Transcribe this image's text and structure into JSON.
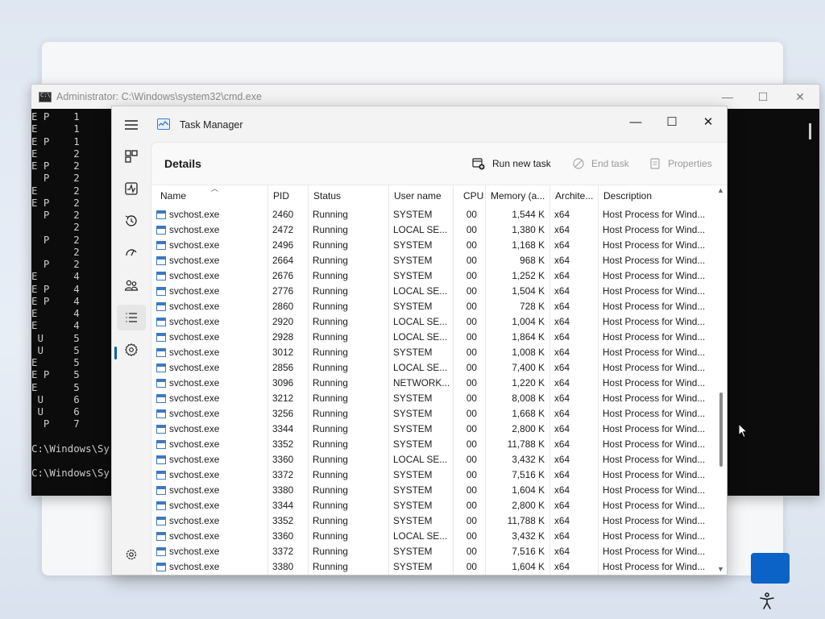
{
  "cmd": {
    "title": "Administrator: C:\\Windows\\system32\\cmd.exe",
    "controls": {
      "minimize": "—",
      "maximize": "☐",
      "close": "✕"
    },
    "lines": [
      "E P    1",
      "E      1",
      "E P    1",
      "E      2",
      "E P    2",
      "  P    2",
      "E      2",
      "E P    2",
      "  P    2",
      "       2",
      "  P    2",
      "       2",
      "  P    2",
      "E      4",
      "E P    4",
      "E P    4",
      "E      4",
      "E      4",
      " U     5",
      " U     5",
      "E      5",
      "E P    5",
      "E      5",
      " U     6",
      " U     6",
      "  P    7",
      "",
      "C:\\Windows\\Sy",
      "",
      "C:\\Windows\\Sy"
    ]
  },
  "taskmgr": {
    "title": "Task Manager",
    "controls": {
      "minimize": "—",
      "maximize": "☐",
      "close": "✕"
    },
    "nav": [
      {
        "name": "processes",
        "icon": "processes-icon"
      },
      {
        "name": "performance",
        "icon": "performance-icon"
      },
      {
        "name": "app-history",
        "icon": "app-history-icon"
      },
      {
        "name": "startup-apps",
        "icon": "startup-apps-icon"
      },
      {
        "name": "users",
        "icon": "users-icon"
      },
      {
        "name": "details",
        "icon": "details-icon",
        "active": true
      },
      {
        "name": "services",
        "icon": "services-icon"
      },
      {
        "name": "settings",
        "icon": "settings-icon"
      }
    ],
    "page_title": "Details",
    "toolbar": {
      "run_new_task": "Run new task",
      "end_task": "End task",
      "properties": "Properties"
    },
    "columns": [
      "Name",
      "PID",
      "Status",
      "User name",
      "CPU",
      "Memory (a...",
      "Archite...",
      "Description"
    ],
    "rows": [
      [
        "svchost.exe",
        "2460",
        "Running",
        "SYSTEM",
        "00",
        "1,544 K",
        "x64",
        "Host Process for Wind..."
      ],
      [
        "svchost.exe",
        "2472",
        "Running",
        "LOCAL SE...",
        "00",
        "1,380 K",
        "x64",
        "Host Process for Wind..."
      ],
      [
        "svchost.exe",
        "2496",
        "Running",
        "SYSTEM",
        "00",
        "1,168 K",
        "x64",
        "Host Process for Wind..."
      ],
      [
        "svchost.exe",
        "2664",
        "Running",
        "SYSTEM",
        "00",
        "968 K",
        "x64",
        "Host Process for Wind..."
      ],
      [
        "svchost.exe",
        "2676",
        "Running",
        "SYSTEM",
        "00",
        "1,252 K",
        "x64",
        "Host Process for Wind..."
      ],
      [
        "svchost.exe",
        "2776",
        "Running",
        "LOCAL SE...",
        "00",
        "1,504 K",
        "x64",
        "Host Process for Wind..."
      ],
      [
        "svchost.exe",
        "2860",
        "Running",
        "SYSTEM",
        "00",
        "728 K",
        "x64",
        "Host Process for Wind..."
      ],
      [
        "svchost.exe",
        "2920",
        "Running",
        "LOCAL SE...",
        "00",
        "1,004 K",
        "x64",
        "Host Process for Wind..."
      ],
      [
        "svchost.exe",
        "2928",
        "Running",
        "LOCAL SE...",
        "00",
        "1,864 K",
        "x64",
        "Host Process for Wind..."
      ],
      [
        "svchost.exe",
        "3012",
        "Running",
        "SYSTEM",
        "00",
        "1,008 K",
        "x64",
        "Host Process for Wind..."
      ],
      [
        "svchost.exe",
        "2856",
        "Running",
        "LOCAL SE...",
        "00",
        "7,400 K",
        "x64",
        "Host Process for Wind..."
      ],
      [
        "svchost.exe",
        "3096",
        "Running",
        "NETWORK...",
        "00",
        "1,220 K",
        "x64",
        "Host Process for Wind..."
      ],
      [
        "svchost.exe",
        "3212",
        "Running",
        "SYSTEM",
        "00",
        "8,008 K",
        "x64",
        "Host Process for Wind..."
      ],
      [
        "svchost.exe",
        "3256",
        "Running",
        "SYSTEM",
        "00",
        "1,668 K",
        "x64",
        "Host Process for Wind..."
      ],
      [
        "svchost.exe",
        "3344",
        "Running",
        "SYSTEM",
        "00",
        "2,800 K",
        "x64",
        "Host Process for Wind..."
      ],
      [
        "svchost.exe",
        "3352",
        "Running",
        "SYSTEM",
        "00",
        "11,788 K",
        "x64",
        "Host Process for Wind..."
      ],
      [
        "svchost.exe",
        "3360",
        "Running",
        "LOCAL SE...",
        "00",
        "3,432 K",
        "x64",
        "Host Process for Wind..."
      ],
      [
        "svchost.exe",
        "3372",
        "Running",
        "SYSTEM",
        "00",
        "7,516 K",
        "x64",
        "Host Process for Wind..."
      ],
      [
        "svchost.exe",
        "3380",
        "Running",
        "SYSTEM",
        "00",
        "1,604 K",
        "x64",
        "Host Process for Wind..."
      ],
      [
        "svchost.exe",
        "3344",
        "Running",
        "SYSTEM",
        "00",
        "2,800 K",
        "x64",
        "Host Process for Wind..."
      ],
      [
        "svchost.exe",
        "3352",
        "Running",
        "SYSTEM",
        "00",
        "11,788 K",
        "x64",
        "Host Process for Wind..."
      ],
      [
        "svchost.exe",
        "3360",
        "Running",
        "LOCAL SE...",
        "00",
        "3,432 K",
        "x64",
        "Host Process for Wind..."
      ],
      [
        "svchost.exe",
        "3372",
        "Running",
        "SYSTEM",
        "00",
        "7,516 K",
        "x64",
        "Host Process for Wind..."
      ],
      [
        "svchost.exe",
        "3380",
        "Running",
        "SYSTEM",
        "00",
        "1,604 K",
        "x64",
        "Host Process for Wind..."
      ]
    ]
  },
  "colors": {
    "accent": "#0b5cad",
    "primary_button": "#0b63c7"
  }
}
